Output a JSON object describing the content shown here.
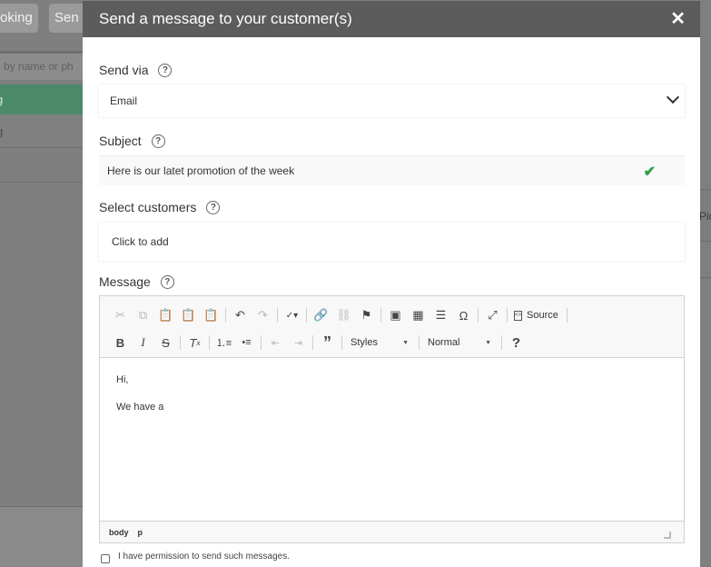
{
  "background": {
    "buttons": [
      "oking",
      "Sen"
    ],
    "search_placeholder": "h by name or ph",
    "rows": [
      "g",
      "g"
    ],
    "right_column_text": "Pic"
  },
  "modal": {
    "title": "Send a message to your customer(s)",
    "close_icon": "close-icon",
    "send_via": {
      "label": "Send via",
      "value": "Email"
    },
    "subject": {
      "label": "Subject",
      "value": "Here is our latet promotion of the week",
      "status": "valid"
    },
    "customers": {
      "label": "Select customers",
      "placeholder": "Click to add"
    },
    "message": {
      "label": "Message",
      "toolbar": {
        "source_label": "Source",
        "styles_label": "Styles",
        "format_label": "Normal"
      },
      "body_lines": [
        "Hi,",
        "We have a"
      ],
      "path": [
        "body",
        "p"
      ]
    },
    "permission_label": "I have permission to send such messages."
  },
  "colors": {
    "header_bg": "#5c5c5c",
    "accent_green": "#2f9e44",
    "overlay": "#7f7f7f"
  }
}
